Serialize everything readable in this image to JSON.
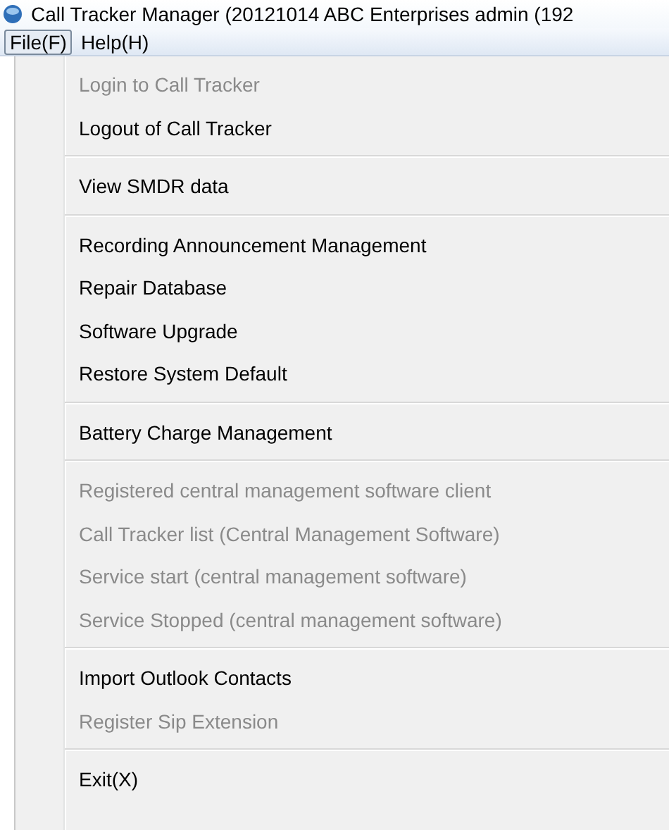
{
  "window": {
    "title": "Call Tracker Manager (20121014 ABC Enterprises admin (192"
  },
  "menu_bar": [
    {
      "label": "File(F)",
      "selected": true
    },
    {
      "label": "Help(H)",
      "selected": false
    }
  ],
  "menu": {
    "groups": [
      {
        "items": [
          {
            "label": "Login to Call Tracker",
            "disabled": true
          },
          {
            "label": "Logout of Call Tracker",
            "disabled": false
          }
        ]
      },
      {
        "items": [
          {
            "label": "View SMDR data",
            "disabled": false
          }
        ]
      },
      {
        "items": [
          {
            "label": "Recording Announcement Management",
            "disabled": false
          },
          {
            "label": "Repair Database",
            "disabled": false
          },
          {
            "label": "Software Upgrade",
            "disabled": false
          },
          {
            "label": "Restore System Default",
            "disabled": false
          }
        ]
      },
      {
        "items": [
          {
            "label": "Battery Charge Management",
            "disabled": false
          }
        ]
      },
      {
        "items": [
          {
            "label": "Registered central management software client",
            "disabled": true
          },
          {
            "label": "Call Tracker list (Central Management Software)",
            "disabled": true
          },
          {
            "label": "Service start (central management software)",
            "disabled": true
          },
          {
            "label": "Service Stopped (central management software)",
            "disabled": true
          }
        ]
      },
      {
        "items": [
          {
            "label": "Import Outlook Contacts",
            "disabled": false
          },
          {
            "label": "Register Sip Extension",
            "disabled": true
          }
        ]
      },
      {
        "items": [
          {
            "label": "Exit(X)",
            "disabled": false
          }
        ]
      }
    ]
  }
}
